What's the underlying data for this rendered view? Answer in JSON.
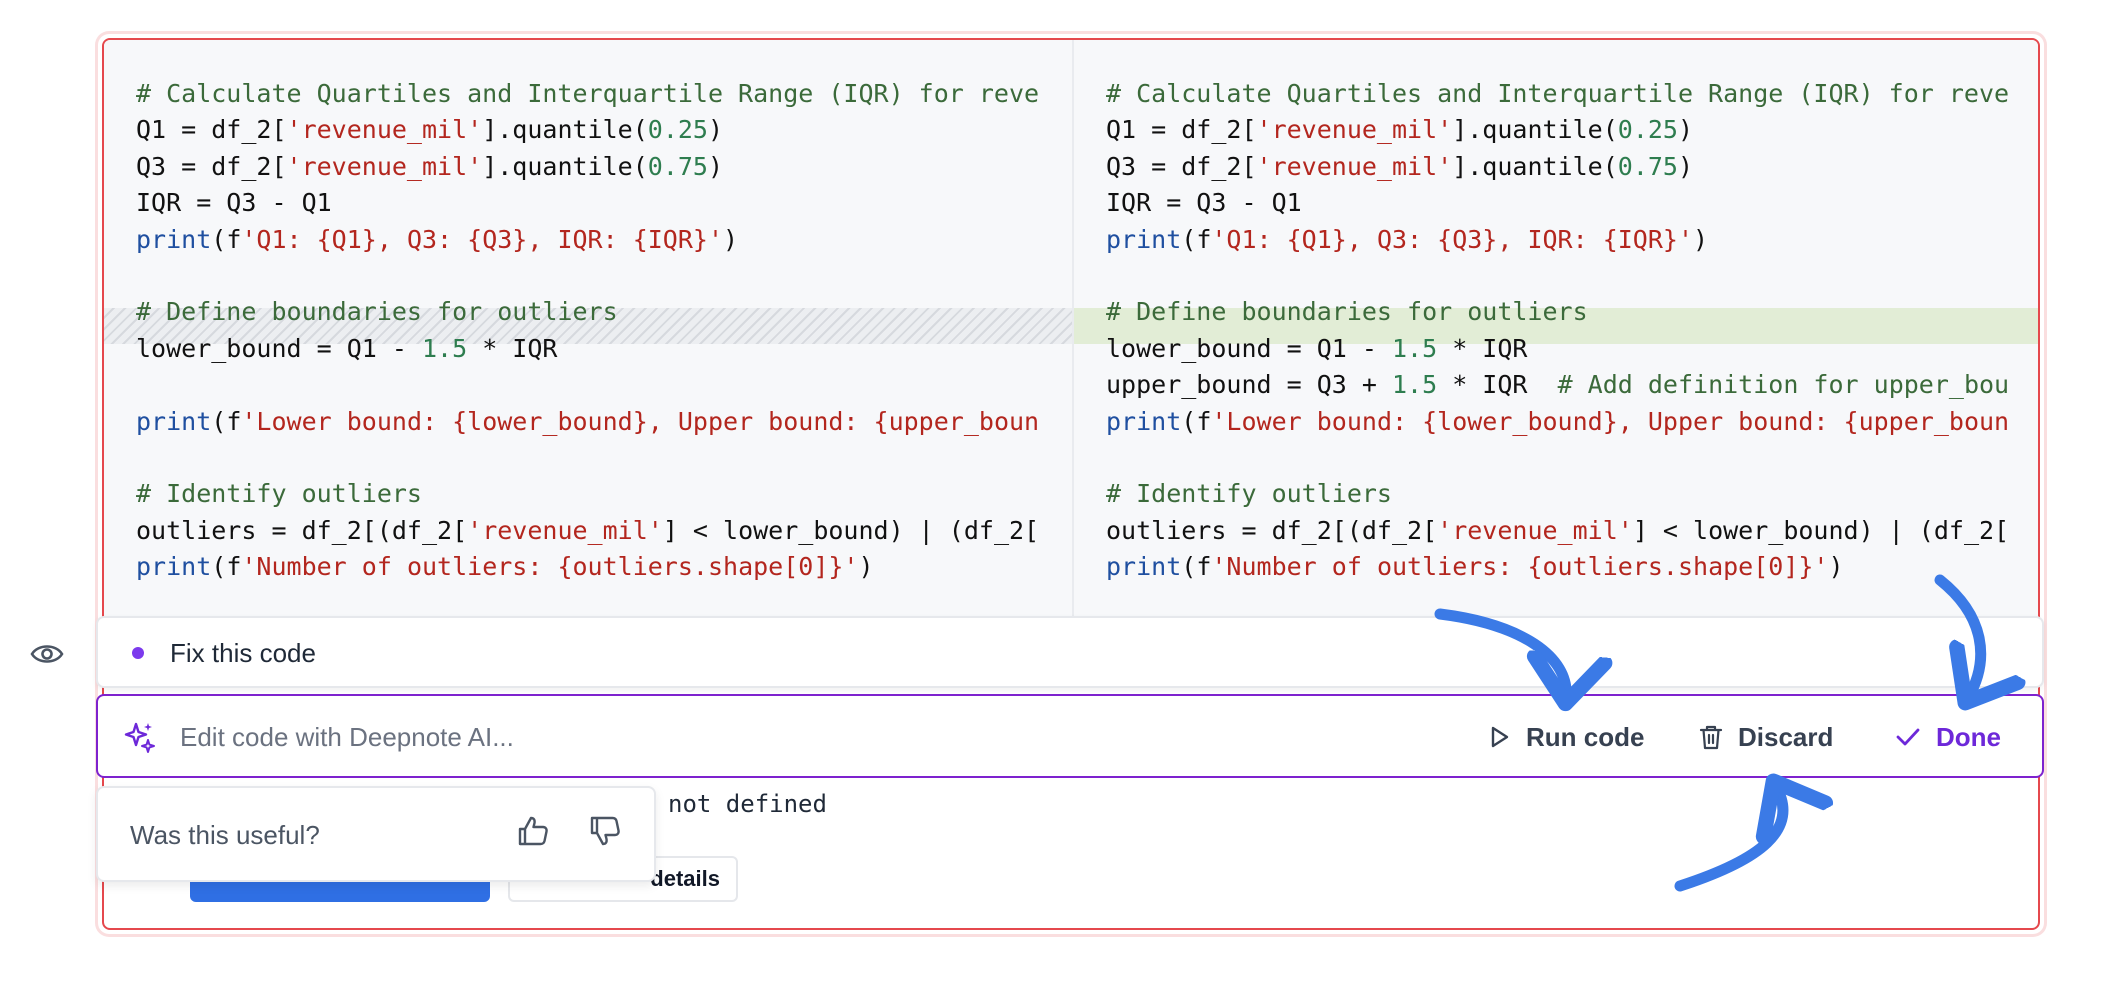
{
  "code_left": [
    "# Calculate Quartiles and Interquartile Range (IQR) for reve",
    "Q1 = df_2['revenue_mil'].quantile(0.25)",
    "Q3 = df_2['revenue_mil'].quantile(0.75)",
    "IQR = Q3 - Q1",
    "print(f'Q1: {Q1}, Q3: {Q3}, IQR: {IQR}')",
    "",
    "# Define boundaries for outliers",
    "lower_bound = Q1 - 1.5 * IQR",
    "",
    "print(f'Lower bound: {lower_bound}, Upper bound: {upper_boun",
    "",
    "# Identify outliers",
    "outliers = df_2[(df_2['revenue_mil'] < lower_bound) | (df_2[",
    "print(f'Number of outliers: {outliers.shape[0]}')"
  ],
  "code_right": [
    "# Calculate Quartiles and Interquartile Range (IQR) for reve",
    "Q1 = df_2['revenue_mil'].quantile(0.25)",
    "Q3 = df_2['revenue_mil'].quantile(0.75)",
    "IQR = Q3 - Q1",
    "print(f'Q1: {Q1}, Q3: {Q3}, IQR: {IQR}')",
    "",
    "# Define boundaries for outliers",
    "lower_bound = Q1 - 1.5 * IQR",
    "upper_bound = Q3 + 1.5 * IQR  # Add definition for upper_bou",
    "print(f'Lower bound: {lower_bound}, Upper bound: {upper_boun",
    "",
    "# Identify outliers",
    "outliers = df_2[(df_2['revenue_mil'] < lower_bound) | (df_2[",
    "print(f'Number of outliers: {outliers.shape[0]}')"
  ],
  "prompt": {
    "text": "Fix this code"
  },
  "ai_bar": {
    "placeholder": "Edit code with Deepnote AI...",
    "run_label": "Run code",
    "discard_label": "Discard",
    "done_label": "Done"
  },
  "feedback": {
    "question": "Was this useful?"
  },
  "output": {
    "error_fragment": "not defined",
    "details_label": "details"
  },
  "colors": {
    "error_border": "#e5484d",
    "ai_accent": "#7e22ce",
    "done_color": "#6d28d9",
    "arrow_blue": "#3b7ae6",
    "added_line": "#e2edd6"
  },
  "icons": [
    "eye-icon",
    "sparkle-icon",
    "play-icon",
    "trash-icon",
    "check-icon",
    "thumbs-up-icon",
    "thumbs-down-icon"
  ]
}
